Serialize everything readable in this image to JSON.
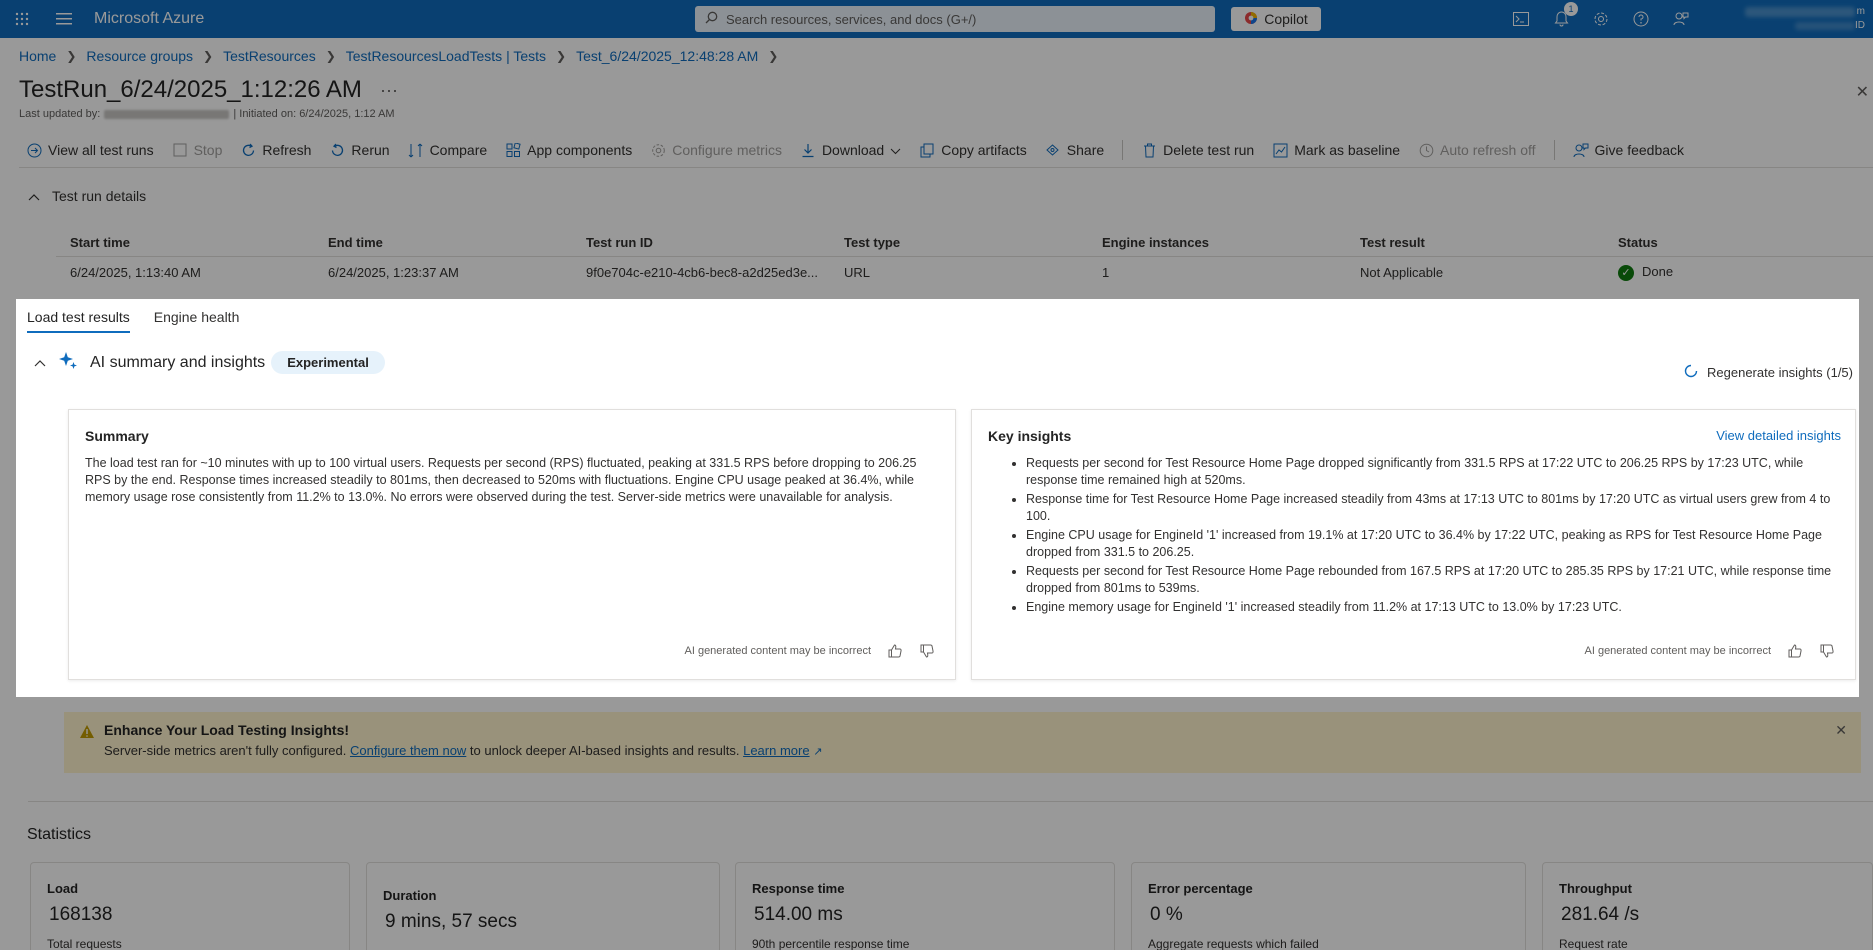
{
  "topbar": {
    "brand": "Microsoft Azure",
    "search_placeholder": "Search resources, services, and docs (G+/)",
    "copilot_label": "Copilot",
    "notification_count": "1",
    "account_right_fragment_1": "m",
    "account_right_fragment_2": "ID"
  },
  "breadcrumb": [
    "Home",
    "Resource groups",
    "TestResources",
    "TestResourcesLoadTests | Tests",
    "Test_6/24/2025_12:48:28 AM"
  ],
  "page": {
    "title": "TestRun_6/24/2025_1:12:26 AM",
    "more": "···",
    "last_updated_label": "Last updated by:",
    "initiated": "| Initiated on: 6/24/2025, 1:12 AM"
  },
  "commands": {
    "view_all": "View all test runs",
    "stop": "Stop",
    "refresh": "Refresh",
    "rerun": "Rerun",
    "compare": "Compare",
    "app_components": "App components",
    "configure_metrics": "Configure metrics",
    "download": "Download",
    "copy_artifacts": "Copy artifacts",
    "share": "Share",
    "delete": "Delete test run",
    "baseline": "Mark as baseline",
    "auto_refresh": "Auto refresh off",
    "feedback": "Give feedback"
  },
  "details": {
    "toggle_label": "Test run details",
    "headers": [
      "Start time",
      "End time",
      "Test run ID",
      "Test type",
      "Engine instances",
      "Test result",
      "Status"
    ],
    "row": [
      "6/24/2025, 1:13:40 AM",
      "6/24/2025, 1:23:37 AM",
      "9f0e704c-e210-4cb6-bec8-a2d25ed3e...",
      "URL",
      "1",
      "Not Applicable",
      "Done"
    ]
  },
  "tabs": [
    "Load test results",
    "Engine health"
  ],
  "ai": {
    "title": "AI summary and insights",
    "badge": "Experimental",
    "regenerate": "Regenerate insights (1/5)",
    "summary_title": "Summary",
    "summary_text": "The load test ran for ~10 minutes with up to 100 virtual users. Requests per second (RPS) fluctuated, peaking at 331.5 RPS before dropping to 206.25 RPS by the end. Response times increased steadily to 801ms, then decreased to 520ms with fluctuations. Engine CPU usage peaked at 36.4%, while memory usage rose consistently from 11.2% to 13.0%. No errors were observed during the test. Server-side metrics were unavailable for analysis.",
    "insights_title": "Key insights",
    "insights_link": "View detailed insights",
    "insights": [
      "Requests per second for Test Resource Home Page dropped significantly from 331.5 RPS at 17:22 UTC to 206.25 RPS by 17:23 UTC, while response time remained high at 520ms.",
      "Response time for Test Resource Home Page increased steadily from 43ms at 17:13 UTC to 801ms by 17:20 UTC as virtual users grew from 4 to 100.",
      "Engine CPU usage for EngineId '1' increased from 19.1% at 17:20 UTC to 36.4% by 17:22 UTC, peaking as RPS for Test Resource Home Page dropped from 331.5 to 206.25.",
      "Requests per second for Test Resource Home Page rebounded from 167.5 RPS at 17:20 UTC to 285.35 RPS by 17:21 UTC, while response time dropped from 801ms to 539ms.",
      "Engine memory usage for EngineId '1' increased steadily from 11.2% at 17:13 UTC to 13.0% by 17:23 UTC."
    ],
    "disclaimer": "AI generated content may be incorrect"
  },
  "banner": {
    "title": "Enhance Your Load Testing Insights!",
    "text_before": "Server-side metrics aren't fully configured. ",
    "link1": "Configure them now",
    "text_middle": " to unlock deeper AI-based insights and results. ",
    "link2": "Learn more"
  },
  "statistics": {
    "title": "Statistics",
    "cards": [
      {
        "label": "Load",
        "value": "168138",
        "sub": "Total requests"
      },
      {
        "label": "Duration",
        "value": "9 mins, 57 secs",
        "sub": ""
      },
      {
        "label": "Response time",
        "value": "514.00 ms",
        "sub": "90th percentile response time"
      },
      {
        "label": "Error percentage",
        "value": "0 %",
        "sub": "Aggregate requests which failed"
      },
      {
        "label": "Throughput",
        "value": "281.64 /s",
        "sub": "Request rate"
      }
    ]
  },
  "colors": {
    "brand": "#0f6cbd",
    "success": "#107c10",
    "warning_bg": "#fff4ce",
    "warning_icon": "#c19c00"
  }
}
